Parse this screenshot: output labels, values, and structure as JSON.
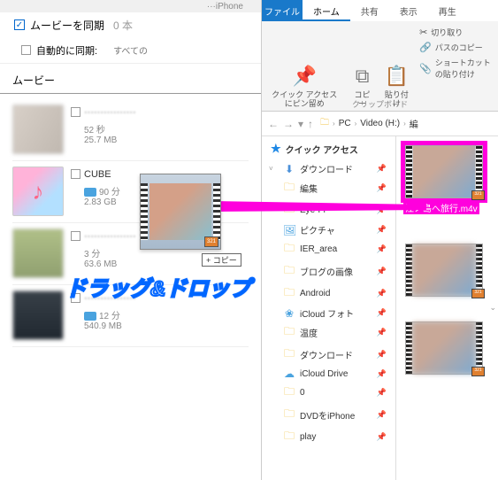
{
  "left": {
    "topCrumb": "···iPhone",
    "syncLabel": "ムービーを同期",
    "syncCount": "0 本",
    "autoSyncLabel": "自動的に同期:",
    "autoDropdown": "すべての",
    "sectionTitle": "ムービー",
    "items": [
      {
        "title": "················",
        "dur": "52 秒",
        "size": "25.7 MB",
        "hd": false
      },
      {
        "title": "CUBE",
        "dur": "90 分",
        "size": "2.83 GB",
        "hd": true,
        "clear": true
      },
      {
        "title": "················",
        "dur": "3 分",
        "size": "63.6 MB",
        "hd": false
      },
      {
        "title": "················",
        "dur": "12 分",
        "size": "540.9 MB",
        "hd": true
      }
    ]
  },
  "drag": {
    "copyHint": "+ コピー",
    "overlay": "ドラッグ&ドロップ"
  },
  "explorer": {
    "fileTab": "ファイル",
    "tabs": [
      "ホーム",
      "共有",
      "表示",
      "再生"
    ],
    "ribbon": {
      "quickAccess": "クイック アクセスにピン留め",
      "copy": "コピー",
      "paste": "貼り付け",
      "cut": "切り取り",
      "copyPath": "パスのコピー",
      "pasteShortcut": "ショートカットの貼り付け",
      "groupLabel": "クリップボード"
    },
    "address": {
      "pc": "PC",
      "drive": "Video (H:)",
      "folder": "編"
    },
    "tree": {
      "header": "クイック アクセス",
      "items": [
        {
          "label": "ダウンロード",
          "icon": "dl"
        },
        {
          "label": "編集",
          "icon": "f"
        },
        {
          "label": "Eye-Fi",
          "icon": "f"
        },
        {
          "label": "ピクチャ",
          "icon": "pic"
        },
        {
          "label": "IER_area",
          "icon": "f"
        },
        {
          "label": "ブログの画像",
          "icon": "f"
        },
        {
          "label": "Android",
          "icon": "f"
        },
        {
          "label": "iCloud フォト",
          "icon": "icl"
        },
        {
          "label": "温度",
          "icon": "f"
        },
        {
          "label": "ダウンロード",
          "icon": "f"
        },
        {
          "label": "iCloud Drive",
          "icon": "drive"
        },
        {
          "label": "0",
          "icon": "f"
        },
        {
          "label": "DVDをiPhone",
          "icon": "f"
        },
        {
          "label": "play",
          "icon": "f"
        }
      ]
    },
    "files": [
      {
        "name": "江ノ島へ旅行.m4v",
        "selected": true
      },
      {
        "name": "",
        "selected": false
      },
      {
        "name": "",
        "selected": false
      }
    ]
  }
}
